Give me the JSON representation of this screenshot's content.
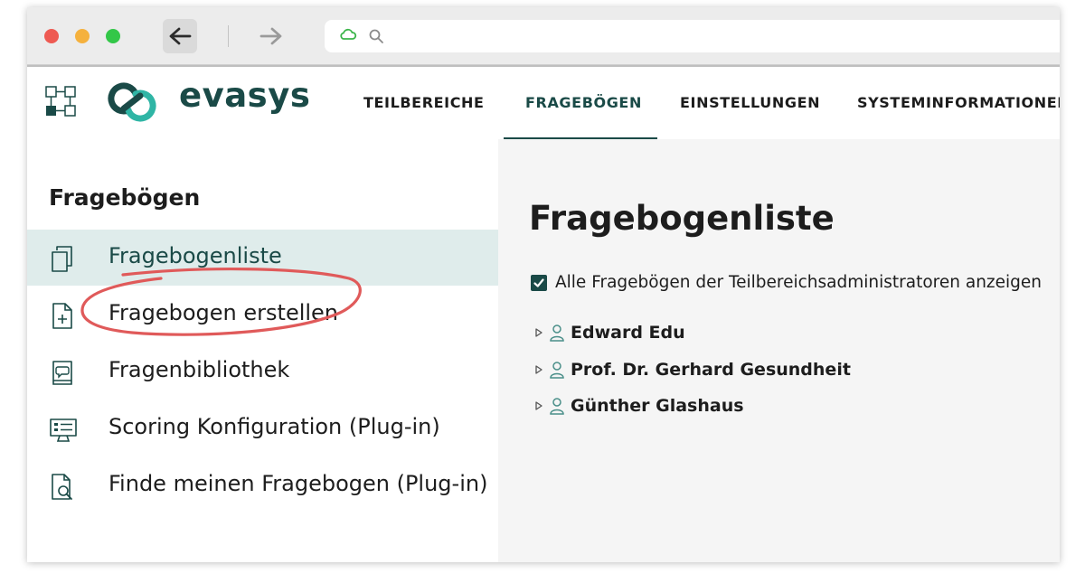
{
  "app": {
    "brand": "evasys",
    "colors": {
      "accent": "#1a4a47",
      "accent_light": "#2fb5a5",
      "active_bg": "#dfeceb",
      "annotation": "#e05a5a"
    }
  },
  "topnav": {
    "items": [
      {
        "label": "TEILBEREICHE",
        "active": false
      },
      {
        "label": "FRAGEBÖGEN",
        "active": true
      },
      {
        "label": "EINSTELLUNGEN",
        "active": false
      },
      {
        "label": "SYSTEMINFORMATIONEN",
        "active": false
      }
    ]
  },
  "sidebar": {
    "title": "Fragebögen",
    "items": [
      {
        "label": "Fragebogenliste",
        "icon": "copy-icon",
        "active": true
      },
      {
        "label": "Fragebogen erstellen",
        "icon": "file-plus-icon",
        "active": false
      },
      {
        "label": "Fragenbibliothek",
        "icon": "book-comment-icon",
        "active": false
      },
      {
        "label": "Scoring Konfiguration (Plug-in)",
        "icon": "monitor-list-icon",
        "active": false
      },
      {
        "label": "Finde meinen Fragebogen (Plug-in)",
        "icon": "file-search-icon",
        "active": false
      }
    ]
  },
  "main": {
    "title": "Fragebogenliste",
    "checkbox": {
      "label": "Alle Fragebögen der Teilbereichsadministratoren anzeigen",
      "checked": true
    },
    "tree": [
      {
        "name": "Edward Edu"
      },
      {
        "name": "Prof. Dr. Gerhard Gesundheit"
      },
      {
        "name": "Günther Glashaus"
      }
    ]
  }
}
